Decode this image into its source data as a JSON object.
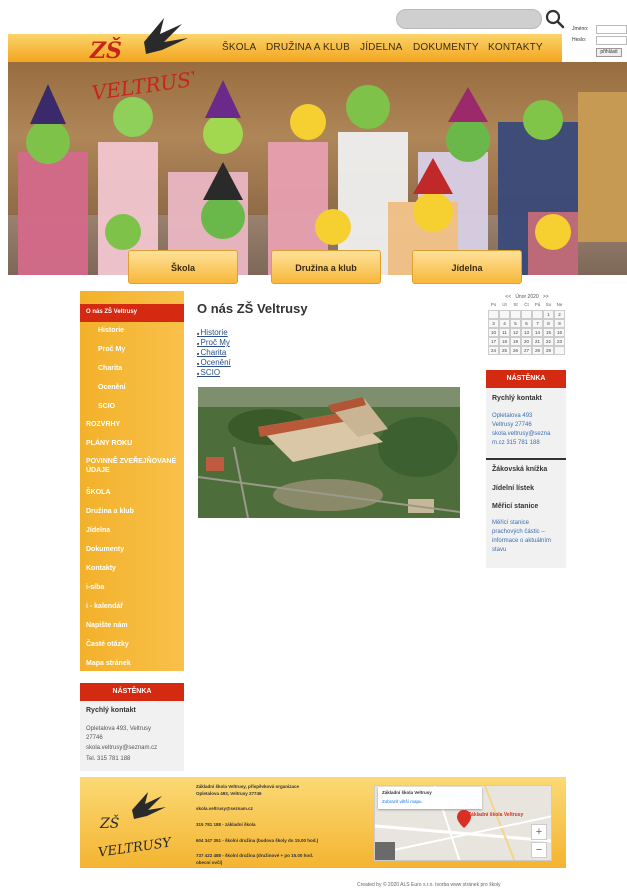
{
  "header": {
    "search_placeholder": "",
    "login_name_label": "Jméno:",
    "login_pass_label": "Heslo:",
    "login_button": "přihlásit",
    "logo_text": "ZŠ VELTRUSY",
    "nav": [
      "ŠKOLA",
      "DRUŽINA A KLUB",
      "JÍDELNA",
      "DOKUMENTY",
      "KONTAKTY"
    ]
  },
  "hero_tabs": [
    "Škola",
    "Družina a klub",
    "Jídelna"
  ],
  "sidebar": {
    "items": [
      {
        "label": "O nás ZŠ Veltrusy",
        "active": true,
        "sub": false
      },
      {
        "label": "Historie",
        "sub": true
      },
      {
        "label": "Proč My",
        "sub": true
      },
      {
        "label": "Charita",
        "sub": true
      },
      {
        "label": "Ocenění",
        "sub": true
      },
      {
        "label": "SCIO",
        "sub": true
      },
      {
        "label": "ROZVRHY",
        "sub": false
      },
      {
        "label": "PLÁNY ROKU",
        "sub": false
      },
      {
        "label": "POVINNĚ ZVEŘEJŇOVANÉ ÚDAJE",
        "sub": false
      },
      {
        "label": "ŠKOLA",
        "sub": false
      },
      {
        "label": "Družina a klub",
        "sub": false
      },
      {
        "label": "Jídelna",
        "sub": false
      },
      {
        "label": "Dokumenty",
        "sub": false
      },
      {
        "label": "Kontakty",
        "sub": false
      },
      {
        "label": "i-síba",
        "sub": false
      },
      {
        "label": "i - kalendář",
        "sub": false
      },
      {
        "label": "Napište nám",
        "sub": false
      },
      {
        "label": "Časté otázky",
        "sub": false
      },
      {
        "label": "Mapa stránek",
        "sub": false
      }
    ],
    "notice_title": "NÁSTĚNKA",
    "notice_heading": "Rychlý kontakt",
    "notice_lines": [
      "Opletalova 493, Veltrusy",
      "27746",
      "skola.veltrusy@seznam.cz",
      "Tel. 315 781 188"
    ]
  },
  "main": {
    "title": "O nás ZŠ Veltrusy",
    "links": [
      "Historie",
      "Proč My",
      "Charita",
      "Ocenění",
      "SCIO"
    ]
  },
  "calendar": {
    "prev": "<<",
    "month": "Únor 2020",
    "next": ">>",
    "days": [
      "Po",
      "Út",
      "St",
      "Čt",
      "Pá",
      "So",
      "Ne"
    ],
    "cells": [
      "",
      "",
      "",
      "",
      "",
      "1",
      "2",
      "3",
      "4",
      "5",
      "6",
      "7",
      "8",
      "9",
      "10",
      "11",
      "12",
      "13",
      "14",
      "15",
      "16",
      "17",
      "18",
      "19",
      "20",
      "21",
      "22",
      "23",
      "24",
      "25",
      "26",
      "27",
      "28",
      "29",
      ""
    ]
  },
  "right": {
    "notice_title": "NÁSTĚNKA",
    "contact_title": "Rychlý kontakt",
    "contact_lines": [
      "Opletalova 493",
      "Veltrusy 27746",
      "skola.veltrusy@sezna",
      "m.cz 315 781 188"
    ],
    "link1": "Žákovská knížka",
    "link2": "Jídelní lístek",
    "link3": "Měřicí stanice",
    "station_lines": [
      "Měřicí stanice",
      "prachových částic –",
      "informace o aktuálním",
      "stavu"
    ]
  },
  "footer": {
    "lines": [
      "Základní škola Veltrusy, příspěvková organizace",
      "Opletalova 493, Veltrusy 27746",
      "",
      "skola.veltrusy@seznam.cz",
      "",
      "315 781 188 - základní škola",
      "",
      "604 347 351 - školní družina (budova školy do 15.00 hod.)",
      "",
      "737 422 488 - školní družina (družinové + po 15.00 hod.",
      "obecní ovčí)"
    ],
    "map_title": "Základní škola Veltrusy",
    "map_link": "Zobrazit větší mapu",
    "map_pin": "Základní škola Veltrusy",
    "map_zoom_in": "+",
    "map_zoom_out": "−",
    "copyright": "Created by © 2020 ALS Euro s.r.o. tvorba www stránek pro školy"
  },
  "colors": {
    "accent_red": "#d42a12",
    "accent_orange": "#f3b12a",
    "link_blue": "#2a4f8a"
  }
}
